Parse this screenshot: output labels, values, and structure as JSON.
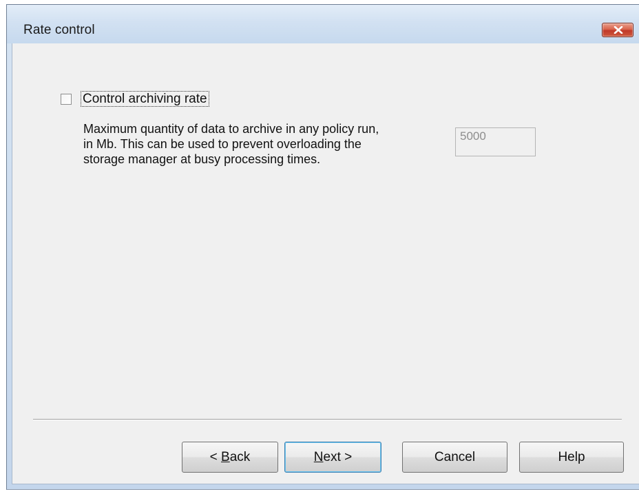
{
  "window": {
    "title": "Rate control",
    "close_icon": "close-x-icon"
  },
  "options": {
    "control_rate": {
      "label": "Control archiving rate",
      "checked": false
    },
    "description_lines": [
      "Maximum quantity of data to archive in any policy run,",
      "in Mb. This can be used to prevent overloading the",
      "storage manager at busy processing times."
    ],
    "max_quantity": {
      "value": "5000",
      "disabled": true
    }
  },
  "buttons": {
    "back": {
      "prefix": "< ",
      "mnemonic": "B",
      "rest": "ack"
    },
    "next": {
      "mnemonic": "N",
      "rest": "ext >"
    },
    "cancel": "Cancel",
    "help": "Help"
  },
  "colors": {
    "titlebar": "#d2e1f2",
    "client_bg": "#f0f0f0",
    "close_button": "#c9503a",
    "default_button_border": "#3c7fb1"
  }
}
